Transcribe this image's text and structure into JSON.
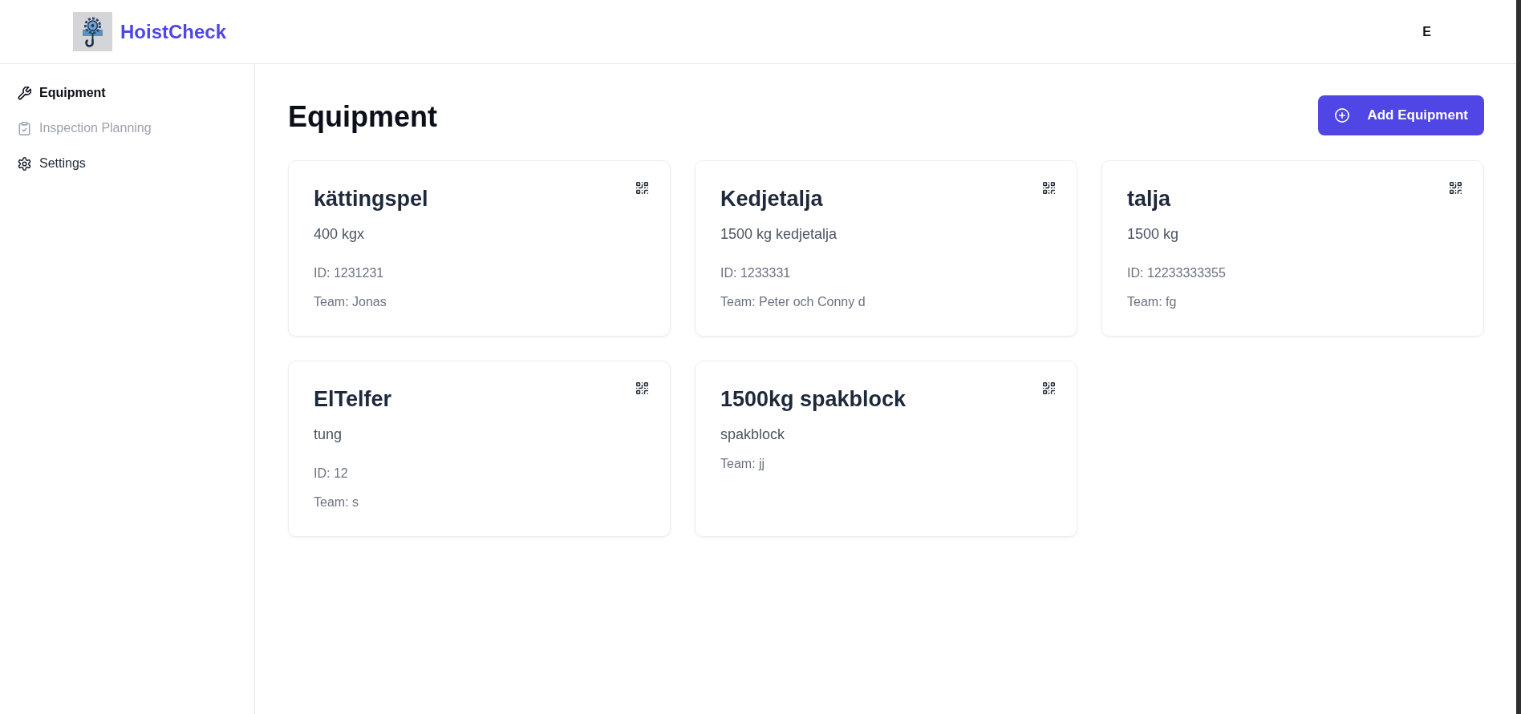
{
  "header": {
    "app_name": "HoistCheck",
    "user_initial": "E"
  },
  "sidebar": {
    "items": [
      {
        "label": "Equipment",
        "selected": true,
        "disabled": false
      },
      {
        "label": "Inspection Planning",
        "selected": false,
        "disabled": true
      },
      {
        "label": "Settings",
        "selected": false,
        "disabled": false
      }
    ]
  },
  "page": {
    "title": "Equipment",
    "add_button": "Add Equipment"
  },
  "equipment": [
    {
      "name": "kättingspel",
      "description": "400 kgx",
      "id": "ID: 1231231",
      "team": "Team: Jonas"
    },
    {
      "name": "Kedjetalja",
      "description": "1500 kg kedjetalja",
      "id": "ID: 1233331",
      "team": "Team: Peter och Conny d"
    },
    {
      "name": "talja",
      "description": "1500 kg",
      "id": "ID: 12233333355",
      "team": "Team: fg"
    },
    {
      "name": "ElTelfer",
      "description": "tung",
      "id": "ID: 12",
      "team": "Team: s"
    },
    {
      "name": "1500kg spakblock",
      "description": "spakblock",
      "team": "Team: jj"
    }
  ]
}
